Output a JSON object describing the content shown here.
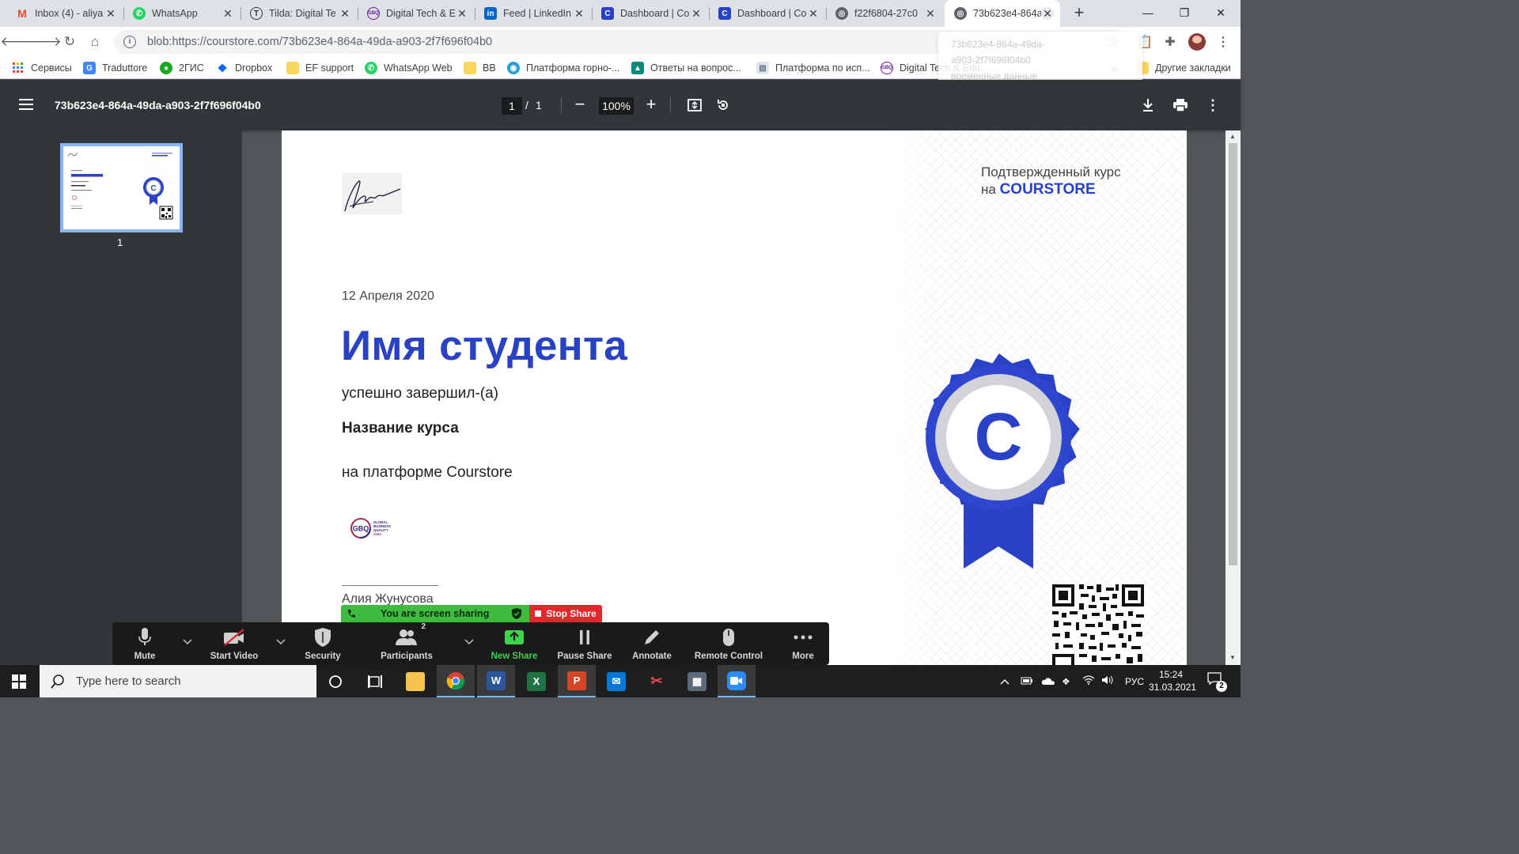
{
  "browser": {
    "tabs": [
      {
        "title": "Inbox (4) - aliya",
        "icon": "gmail-icon",
        "color": "#ea4335"
      },
      {
        "title": "WhatsApp",
        "icon": "whatsapp-icon",
        "color": "#25d366"
      },
      {
        "title": "Tilda: Digital Te",
        "icon": "tilda-icon",
        "color": "#333333"
      },
      {
        "title": "Digital Tech & E",
        "icon": "gbq-icon",
        "color": "#6a1b9a"
      },
      {
        "title": "Feed | LinkedIn",
        "icon": "linkedin-icon",
        "color": "#0a66c2"
      },
      {
        "title": "Dashboard | Co",
        "icon": "coursestore-icon",
        "color": "#2841c5"
      },
      {
        "title": "Dashboard | Co",
        "icon": "coursestore-icon",
        "color": "#2841c5"
      },
      {
        "title": "f22f6804-27c0",
        "icon": "globe-icon",
        "color": "#5f6368"
      },
      {
        "title": "73b623e4-864a",
        "icon": "globe-icon",
        "color": "#5f6368"
      }
    ],
    "url": "blob:https://courstore.com/73b623e4-864a-49da-a903-2f7f696f04b0",
    "dropdown_ghost": [
      "73b623e4-864a-49da-",
      "a903-2f7f696f04b0",
      "временные данные"
    ],
    "bookmarks": [
      {
        "label": "Сервисы",
        "icon": "apps-grid-icon"
      },
      {
        "label": "Traduttore",
        "icon": "translate-icon"
      },
      {
        "label": "2ГИС",
        "icon": "2gis-icon"
      },
      {
        "label": "Dropbox",
        "icon": "dropbox-icon"
      },
      {
        "label": "EF support",
        "icon": "folder-icon"
      },
      {
        "label": "WhatsApp Web",
        "icon": "whatsapp-icon"
      },
      {
        "label": "BB",
        "icon": "folder-icon"
      },
      {
        "label": "Платформа горно-...",
        "icon": "globe-icon"
      },
      {
        "label": "Ответы на вопрос...",
        "icon": "site-icon"
      },
      {
        "label": "Платформа по исп...",
        "icon": "doc-icon"
      },
      {
        "label": "Digital Tech & Edu...",
        "icon": "gbq-icon"
      }
    ],
    "bookmarks_more": "»",
    "other_bookmarks": "Другие закладки"
  },
  "pdf_viewer": {
    "title": "73b623e4-864a-49da-a903-2f7f696f04b0",
    "current_page": "1",
    "page_separator": "/",
    "total_pages": "1",
    "zoom": "100%",
    "thumbnail_label": "1"
  },
  "certificate": {
    "verified_line1": "Подтвержденный курс",
    "verified_prefix": "на",
    "verified_brand": "COURSTORE",
    "date": "12 Апреля 2020",
    "student_name": "Имя студента",
    "completed_text": "успешно завершил-(а)",
    "course_name": "Название курса",
    "platform_text": "на платформе Courstore",
    "partner_logo_text": [
      "GBQ",
      "GLOBAL",
      "BUSINESS",
      "QUALITY",
      "ASIA"
    ],
    "signer": "Алия Жунусова",
    "seal_letter": "C",
    "colors": {
      "brand_blue": "#2841c5"
    }
  },
  "zoom_meeting": {
    "banner_text": "You are screen sharing",
    "stop_share_label": "Stop Share",
    "controls": [
      {
        "label": "Mute",
        "icon": "microphone-icon"
      },
      {
        "label": "Start Video",
        "icon": "video-off-icon"
      },
      {
        "label": "Security",
        "icon": "shield-icon"
      },
      {
        "label": "Participants",
        "icon": "participants-icon",
        "count": "2"
      },
      {
        "label": "New Share",
        "icon": "share-up-icon"
      },
      {
        "label": "Pause Share",
        "icon": "pause-icon"
      },
      {
        "label": "Annotate",
        "icon": "pencil-icon"
      },
      {
        "label": "Remote Control",
        "icon": "mouse-icon"
      },
      {
        "label": "More",
        "icon": "more-dots-icon"
      }
    ]
  },
  "taskbar": {
    "search_placeholder": "Type here to search",
    "language": "РУС",
    "time": "15:24",
    "date": "31.03.2021",
    "notification_count": "2"
  }
}
